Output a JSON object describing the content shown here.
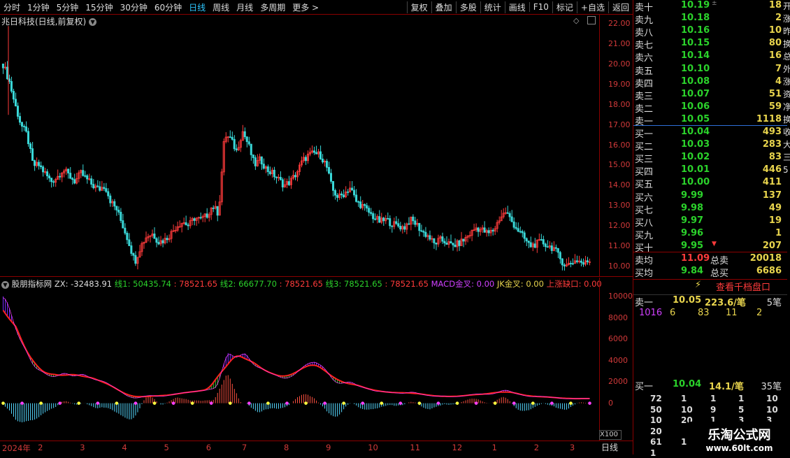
{
  "toolbar": {
    "tabs": [
      "分时",
      "1分钟",
      "5分钟",
      "15分钟",
      "30分钟",
      "60分钟",
      "日线",
      "周线",
      "月线",
      "多周期",
      "更多 >"
    ],
    "active": "日线",
    "right_buttons": [
      "复权",
      "叠加",
      "多股",
      "统计",
      "画线",
      "F10",
      "标记",
      "+自选",
      "返回"
    ]
  },
  "main_chart": {
    "title": "兆日科技(日线,前复权)",
    "y_ticks": [
      "22.00",
      "21.00",
      "20.00",
      "19.00",
      "18.00",
      "17.00",
      "16.00",
      "15.00",
      "14.00",
      "13.00",
      "12.00",
      "11.00",
      "10.00"
    ],
    "colors": {
      "up": "#ff3b3b",
      "down": "#3ad8d8"
    }
  },
  "indicator": {
    "title": "股朋指标网",
    "zx": "ZX: -32483.91",
    "l1": "线1: 50435.74",
    "l1b": ": 78521.65",
    "l2": "线2: 66677.70",
    "l2b": ": 78521.65",
    "l3": "线3: 78521.65",
    "l3b": ": 78521.65",
    "macd": "MACD金叉: 0.00",
    "jk": "JK金叉: 0.00",
    "gap": "上涨缺口: 0.00",
    "y_ticks": [
      "10000",
      "8000",
      "6000",
      "4000",
      "2000",
      "0"
    ],
    "unit": "X100"
  },
  "date_axis": [
    "2024年",
    "2",
    "3",
    "4",
    "5",
    "6",
    "7",
    "8",
    "9",
    "10",
    "11",
    "12",
    "1",
    "2",
    "3"
  ],
  "period_label": "日线",
  "chart_data": {
    "type": "candlestick",
    "title": "兆日科技(日线,前复权)",
    "ylim": [
      9.5,
      22.5
    ],
    "months": [
      "2024年",
      "2",
      "3",
      "4",
      "5",
      "6",
      "7",
      "8",
      "9",
      "10",
      "11",
      "12",
      "1",
      "2",
      "3"
    ],
    "closes_by_segment": [
      {
        "month": "2024年",
        "close": [
          20.0,
          19.2,
          18.0,
          17.0,
          16.5,
          15.0
        ]
      },
      {
        "month": "2",
        "close": [
          15.0,
          14.6,
          14.2,
          14.4,
          14.8,
          14.5,
          14.2
        ]
      },
      {
        "month": "3",
        "close": [
          14.6,
          14.3,
          14.0,
          13.8,
          14.0,
          13.2,
          12.8
        ]
      },
      {
        "month": "4",
        "close": [
          12.0,
          11.2,
          10.2,
          11.0,
          11.5,
          11.6,
          11.2
        ]
      },
      {
        "month": "5",
        "close": [
          11.3,
          11.6,
          12.0,
          12.2,
          12.0,
          12.4,
          12.3
        ]
      },
      {
        "month": "6",
        "close": [
          12.5,
          13.0,
          12.6,
          16.5,
          16.3,
          15.7
        ]
      },
      {
        "month": "7",
        "close": [
          16.7,
          16.0,
          15.0,
          15.3,
          14.8,
          14.6,
          14.3
        ]
      },
      {
        "month": "8",
        "close": [
          14.0,
          14.2,
          14.6,
          15.2,
          15.5,
          15.6,
          15.5
        ]
      },
      {
        "month": "9",
        "close": [
          15.0,
          13.8,
          13.4,
          13.6,
          13.9,
          13.2,
          13.0
        ]
      },
      {
        "month": "10",
        "close": [
          12.7,
          12.4,
          12.2,
          12.3,
          12.1,
          12.0,
          11.9
        ]
      },
      {
        "month": "11",
        "close": [
          12.3,
          12.1,
          11.7,
          11.5,
          11.1,
          11.3,
          11.2
        ]
      },
      {
        "month": "12",
        "close": [
          11.0,
          11.1,
          11.3,
          11.6,
          11.9,
          11.8,
          11.6
        ]
      },
      {
        "month": "1",
        "close": [
          11.8,
          12.4,
          12.7,
          12.2,
          11.8,
          11.4,
          11.0
        ]
      },
      {
        "month": "2",
        "close": [
          11.1,
          11.2,
          11.0,
          10.9,
          10.4,
          10.0
        ]
      },
      {
        "month": "3",
        "close": [
          10.2,
          10.3,
          10.1,
          10.3
        ]
      }
    ]
  },
  "order_book": {
    "asks": [
      {
        "label": "卖十",
        "price": "10.19",
        "vol": "18",
        "marker": "±"
      },
      {
        "label": "卖九",
        "price": "10.18",
        "vol": "2"
      },
      {
        "label": "卖八",
        "price": "10.16",
        "vol": "10"
      },
      {
        "label": "卖七",
        "price": "10.15",
        "vol": "80"
      },
      {
        "label": "卖六",
        "price": "10.14",
        "vol": "16"
      },
      {
        "label": "卖五",
        "price": "10.10",
        "vol": "7"
      },
      {
        "label": "卖四",
        "price": "10.08",
        "vol": "4"
      },
      {
        "label": "卖三",
        "price": "10.07",
        "vol": "51"
      },
      {
        "label": "卖二",
        "price": "10.06",
        "vol": "59"
      },
      {
        "label": "卖一",
        "price": "10.05",
        "vol": "1118"
      }
    ],
    "bids": [
      {
        "label": "买一",
        "price": "10.04",
        "vol": "493"
      },
      {
        "label": "买二",
        "price": "10.03",
        "vol": "283"
      },
      {
        "label": "买三",
        "price": "10.02",
        "vol": "83"
      },
      {
        "label": "买四",
        "price": "10.01",
        "vol": "446"
      },
      {
        "label": "买五",
        "price": "10.00",
        "vol": "411"
      },
      {
        "label": "买六",
        "price": "9.99",
        "vol": "137"
      },
      {
        "label": "买七",
        "price": "9.98",
        "vol": "49"
      },
      {
        "label": "买八",
        "price": "9.97",
        "vol": "19"
      },
      {
        "label": "买九",
        "price": "9.96",
        "vol": "1"
      },
      {
        "label": "买十",
        "price": "9.95",
        "vol": "207",
        "marker": "▼"
      }
    ],
    "avg_ask_label": "卖均",
    "avg_ask": "11.09",
    "total_ask_label": "总卖",
    "total_ask": "20018",
    "avg_bid_label": "买均",
    "avg_bid": "9.84",
    "total_bid_label": "总买",
    "total_bid": "6686"
  },
  "view_button": "查看千档盘口",
  "sell1_detail": {
    "label": "卖一",
    "price": "10.05",
    "amount": "223.6/笔",
    "count": "5笔"
  },
  "sell1_queue": [
    "1016",
    "6",
    "83",
    "11",
    "2"
  ],
  "buy1_detail": {
    "label": "买一",
    "price": "10.04",
    "amount": "14.1/笔",
    "count": "35笔"
  },
  "buy1_queue_rows": [
    [
      "72",
      "1",
      "1",
      "1",
      "10"
    ],
    [
      "50",
      "10",
      "9",
      "5",
      "10"
    ],
    [
      "10",
      "20",
      "1",
      "3",
      "3"
    ],
    [
      "20",
      "",
      "",
      "",
      ""
    ],
    [
      "61",
      "1",
      "",
      "",
      ""
    ],
    [
      "1",
      "",
      "",
      "",
      ""
    ]
  ],
  "watermark": {
    "line1": "乐淘公式网",
    "line2": "www.60lt.com"
  },
  "right_edge_chars": [
    "开",
    "涨",
    "昨",
    "换",
    "总",
    "外",
    "涨",
    "资",
    "净",
    "换",
    "收",
    "大",
    "三",
    "5"
  ]
}
